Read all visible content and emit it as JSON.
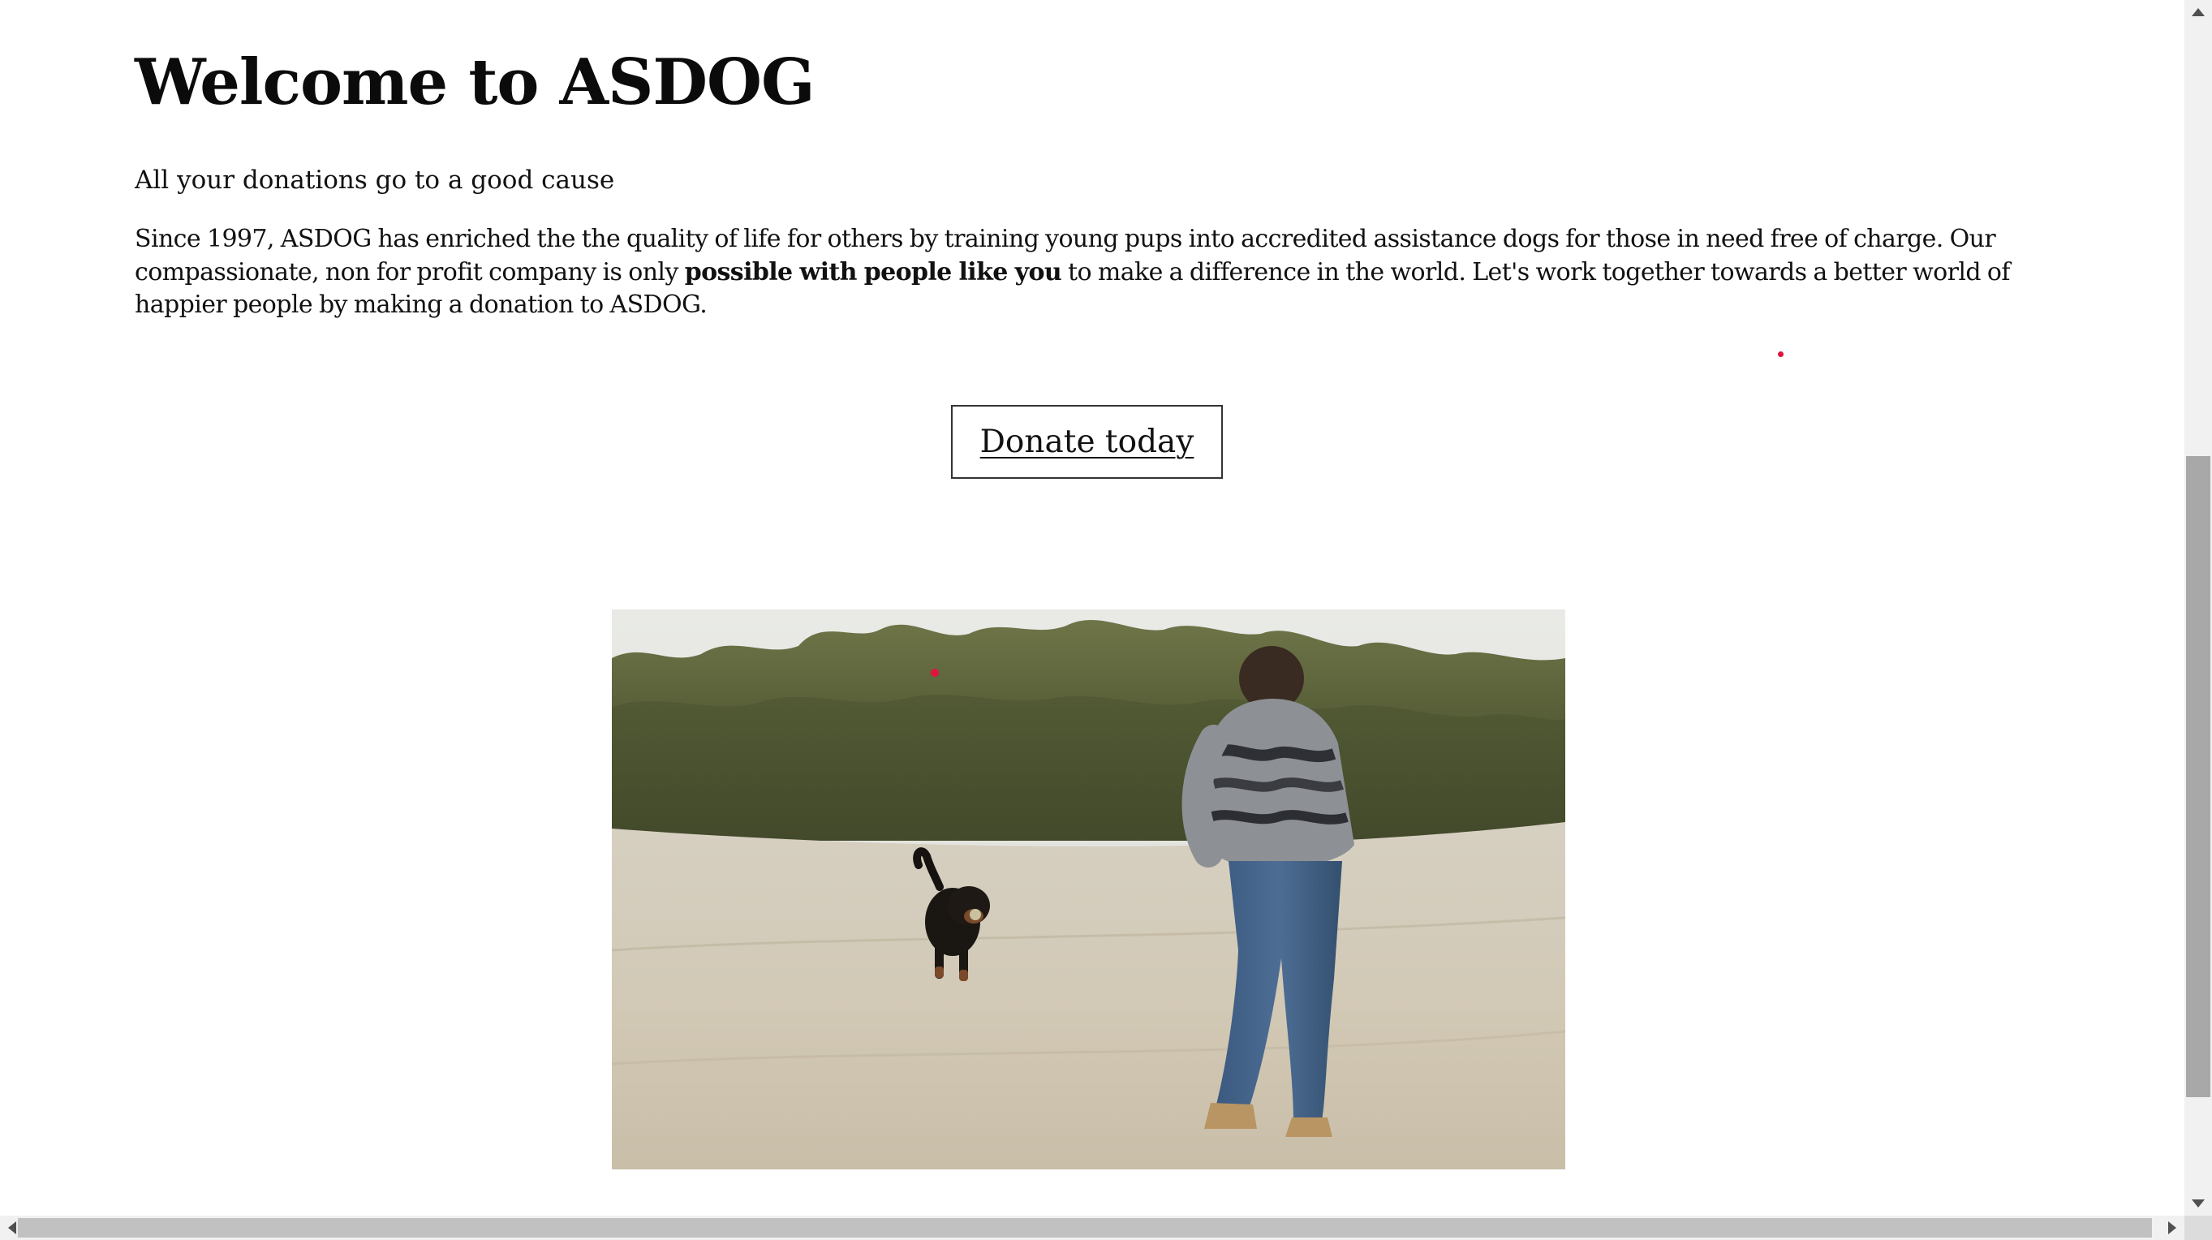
{
  "page": {
    "title": "Welcome to ASDOG",
    "tagline": "All your donations go to a good cause",
    "intro": {
      "before_bold": "Since 1997, ASDOG has enriched the the quality of life for others by training young pups into accredited assistance dogs for those in need free of charge. Our compassionate, non for profit company is only ",
      "bold": "possible with people like you",
      "after_bold": " to make a difference in the world. Let's work together towards a better world of happier people by making a donation to ASDOG."
    },
    "donate_button_label": "Donate today"
  },
  "colors": {
    "accent_dot": "#e0143c",
    "text": "#111111",
    "background": "#ffffff"
  },
  "icons": {
    "scroll_up": "triangle-up",
    "scroll_down": "triangle-down",
    "scroll_left": "triangle-left",
    "scroll_right": "triangle-right"
  }
}
